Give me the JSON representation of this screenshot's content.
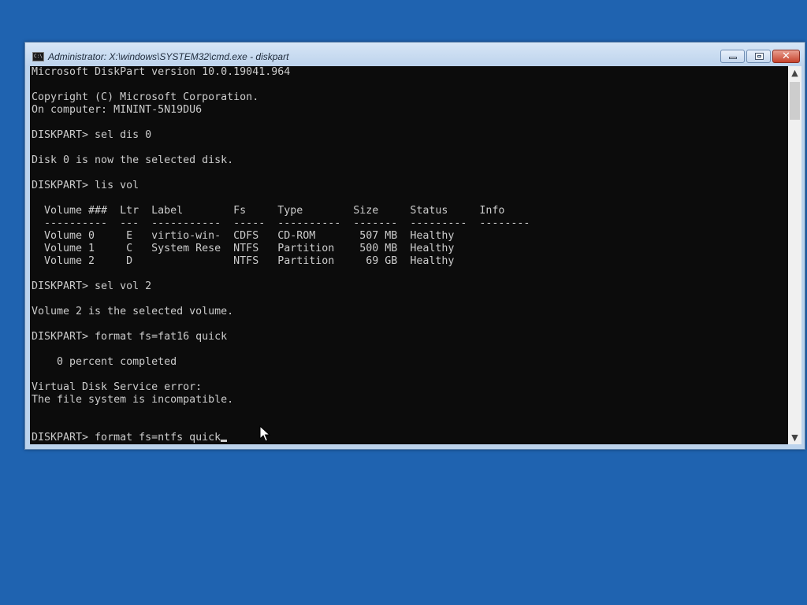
{
  "window": {
    "title": "Administrator: X:\\windows\\SYSTEM32\\cmd.exe - diskpart",
    "icon_text": "C:\\",
    "icon": "cmd-icon",
    "minimize": "minimize-icon",
    "maximize": "maximize-icon",
    "close_label": "✕"
  },
  "console": {
    "lines": [
      "Microsoft DiskPart version 10.0.19041.964",
      "",
      "Copyright (C) Microsoft Corporation.",
      "On computer: MININT-5N19DU6",
      "",
      "DISKPART> sel dis 0",
      "",
      "Disk 0 is now the selected disk.",
      "",
      "DISKPART> lis vol",
      "",
      "  Volume ###  Ltr  Label        Fs     Type        Size     Status     Info",
      "  ----------  ---  -----------  -----  ----------  -------  ---------  --------",
      "  Volume 0     E   virtio-win-  CDFS   CD-ROM       507 MB  Healthy",
      "  Volume 1     C   System Rese  NTFS   Partition    500 MB  Healthy",
      "  Volume 2     D                NTFS   Partition     69 GB  Healthy",
      "",
      "DISKPART> sel vol 2",
      "",
      "Volume 2 is the selected volume.",
      "",
      "DISKPART> format fs=fat16 quick",
      "",
      "    0 percent completed",
      "",
      "Virtual Disk Service error:",
      "The file system is incompatible.",
      "",
      ""
    ],
    "input_line": "DISKPART> format fs=ntfs quick"
  },
  "scrollbar": {
    "up": "▲",
    "down": "▼"
  },
  "colors": {
    "desktop": "#1f63b0",
    "console_bg": "#0c0c0c",
    "console_fg": "#cccccc"
  }
}
